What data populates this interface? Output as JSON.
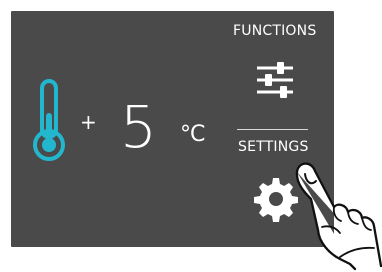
{
  "display": {
    "temperature": {
      "sign": "+",
      "value": "5",
      "unit": "°C"
    },
    "menu": {
      "functions_label": "FUNCTIONS",
      "settings_label": "SETTINGS"
    }
  },
  "icons": {
    "thermometer": "thermometer-icon",
    "functions": "sliders-icon",
    "settings": "gear-icon",
    "touch": "finger-pointer"
  },
  "colors": {
    "panel": "#4a4a4a",
    "text": "#ffffff",
    "thermometer_accent": "#23b7cf"
  }
}
